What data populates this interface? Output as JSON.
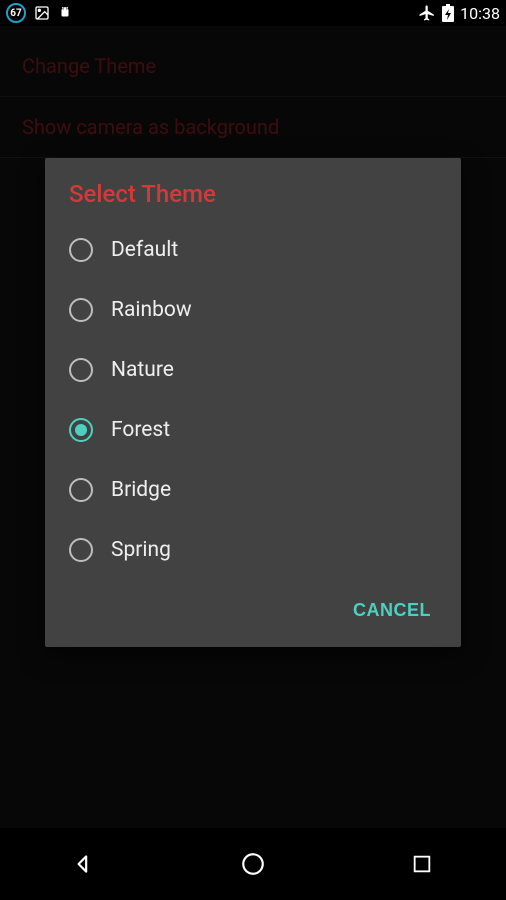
{
  "status": {
    "badge": "67",
    "clock": "10:38"
  },
  "background_settings": {
    "row1": "Change Theme",
    "row2": "Show camera as background"
  },
  "dialog": {
    "title": "Select Theme",
    "options": [
      {
        "label": "Default",
        "selected": false
      },
      {
        "label": "Rainbow",
        "selected": false
      },
      {
        "label": "Nature",
        "selected": false
      },
      {
        "label": "Forest",
        "selected": true
      },
      {
        "label": "Bridge",
        "selected": false
      },
      {
        "label": "Spring",
        "selected": false
      }
    ],
    "cancel": "CANCEL"
  }
}
